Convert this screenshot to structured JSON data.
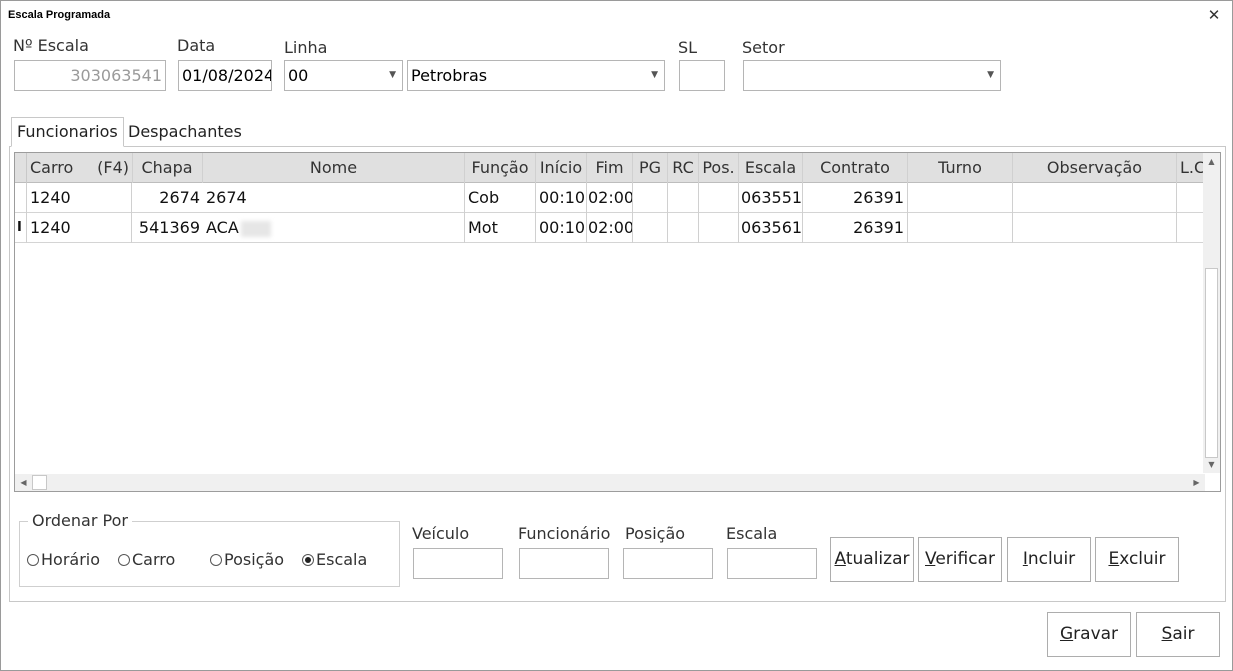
{
  "window": {
    "title": "Escala Programada",
    "close_glyph": "✕"
  },
  "form": {
    "n_escala": {
      "label": "Nº Escala",
      "value": "303063541"
    },
    "data": {
      "label": "Data",
      "value": "01/08/2024"
    },
    "linha": {
      "label": "Linha",
      "code": "00",
      "name": "Petrobras"
    },
    "sl": {
      "label": "SL",
      "value": ""
    },
    "setor": {
      "label": "Setor",
      "value": ""
    }
  },
  "tabs": [
    {
      "label": "Funcionarios",
      "active": true
    },
    {
      "label": "Despachantes",
      "active": false
    }
  ],
  "grid": {
    "columns": [
      "Carro",
      "(F4)",
      "Chapa",
      "Nome",
      "Função",
      "Início",
      "Fim",
      "PG",
      "RC",
      "Pos.",
      "Escala",
      "Contrato",
      "Turno",
      "Observação",
      "L.C"
    ],
    "rows": [
      {
        "marker": "",
        "carro": "1240",
        "chapa": "2674",
        "nome": "2674",
        "funcao": "Cob",
        "inicio": "00:10",
        "fim": "02:00",
        "pg": "",
        "rc": "",
        "pos": "",
        "escala": "063551",
        "contrato": "26391",
        "turno": "",
        "observacao": "",
        "lc": ""
      },
      {
        "marker": "I",
        "carro": "1240",
        "chapa": "541369",
        "nome": "ACA",
        "funcao": "Mot",
        "inicio": "00:10",
        "fim": "02:00",
        "pg": "",
        "rc": "",
        "pos": "",
        "escala": "063561",
        "contrato": "26391",
        "turno": "",
        "observacao": "",
        "lc": ""
      }
    ]
  },
  "ordenar_por": {
    "title": "Ordenar Por",
    "options": [
      {
        "label": "Horário",
        "selected": false
      },
      {
        "label": "Carro",
        "selected": false
      },
      {
        "label": "Posição",
        "selected": false
      },
      {
        "label": "Escala",
        "selected": true
      }
    ]
  },
  "filters": {
    "veiculo": {
      "label": "Veículo",
      "value": ""
    },
    "funcionario": {
      "label": "Funcionário",
      "value": ""
    },
    "posicao": {
      "label": "Posição",
      "value": ""
    },
    "escala": {
      "label": "Escala",
      "value": ""
    }
  },
  "actions": {
    "atualizar": {
      "mnemonic": "A",
      "rest": "tualizar"
    },
    "verificar": {
      "mnemonic": "V",
      "rest": "erificar"
    },
    "incluir": {
      "mnemonic": "I",
      "rest": "ncluir"
    },
    "excluir": {
      "mnemonic": "E",
      "rest": "xcluir"
    },
    "gravar": {
      "mnemonic": "G",
      "rest": "ravar"
    },
    "sair": {
      "mnemonic": "S",
      "rest": "air"
    }
  }
}
